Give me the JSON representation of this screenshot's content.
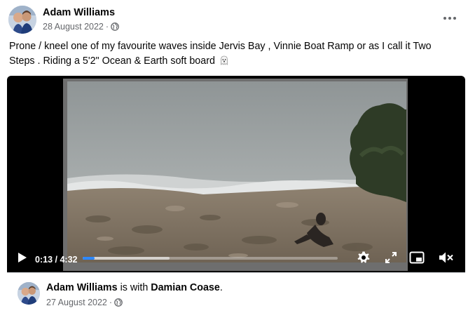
{
  "post": {
    "author": "Adam Williams",
    "date": "28 August 2022",
    "separator": "·",
    "privacy_icon": "globe-icon",
    "more_icon": "more-options-icon",
    "caption": "Prone / kneel one of my favourite waves inside Jervis Bay , Vinnie Boat Ramp or as I call it Two Steps . Riding a 5'2\" Ocean & Earth soft board",
    "caption_emoji": "ghost-emoji"
  },
  "video": {
    "current_time": "0:13",
    "duration": "4:32",
    "time_separator": " / ",
    "progress_fraction": 0.048,
    "buffered_fraction": 0.34,
    "progress_color": "#2d88ff",
    "controls": [
      "play-icon",
      "settings-icon",
      "fullscreen-icon",
      "miniplayer-icon",
      "mute-icon"
    ]
  },
  "shared_post": {
    "author": "Adam Williams",
    "with_text": "is with",
    "tagged": "Damian Coase",
    "end": ".",
    "date": "27 August 2022",
    "separator": "·",
    "privacy_icon": "globe-icon"
  }
}
